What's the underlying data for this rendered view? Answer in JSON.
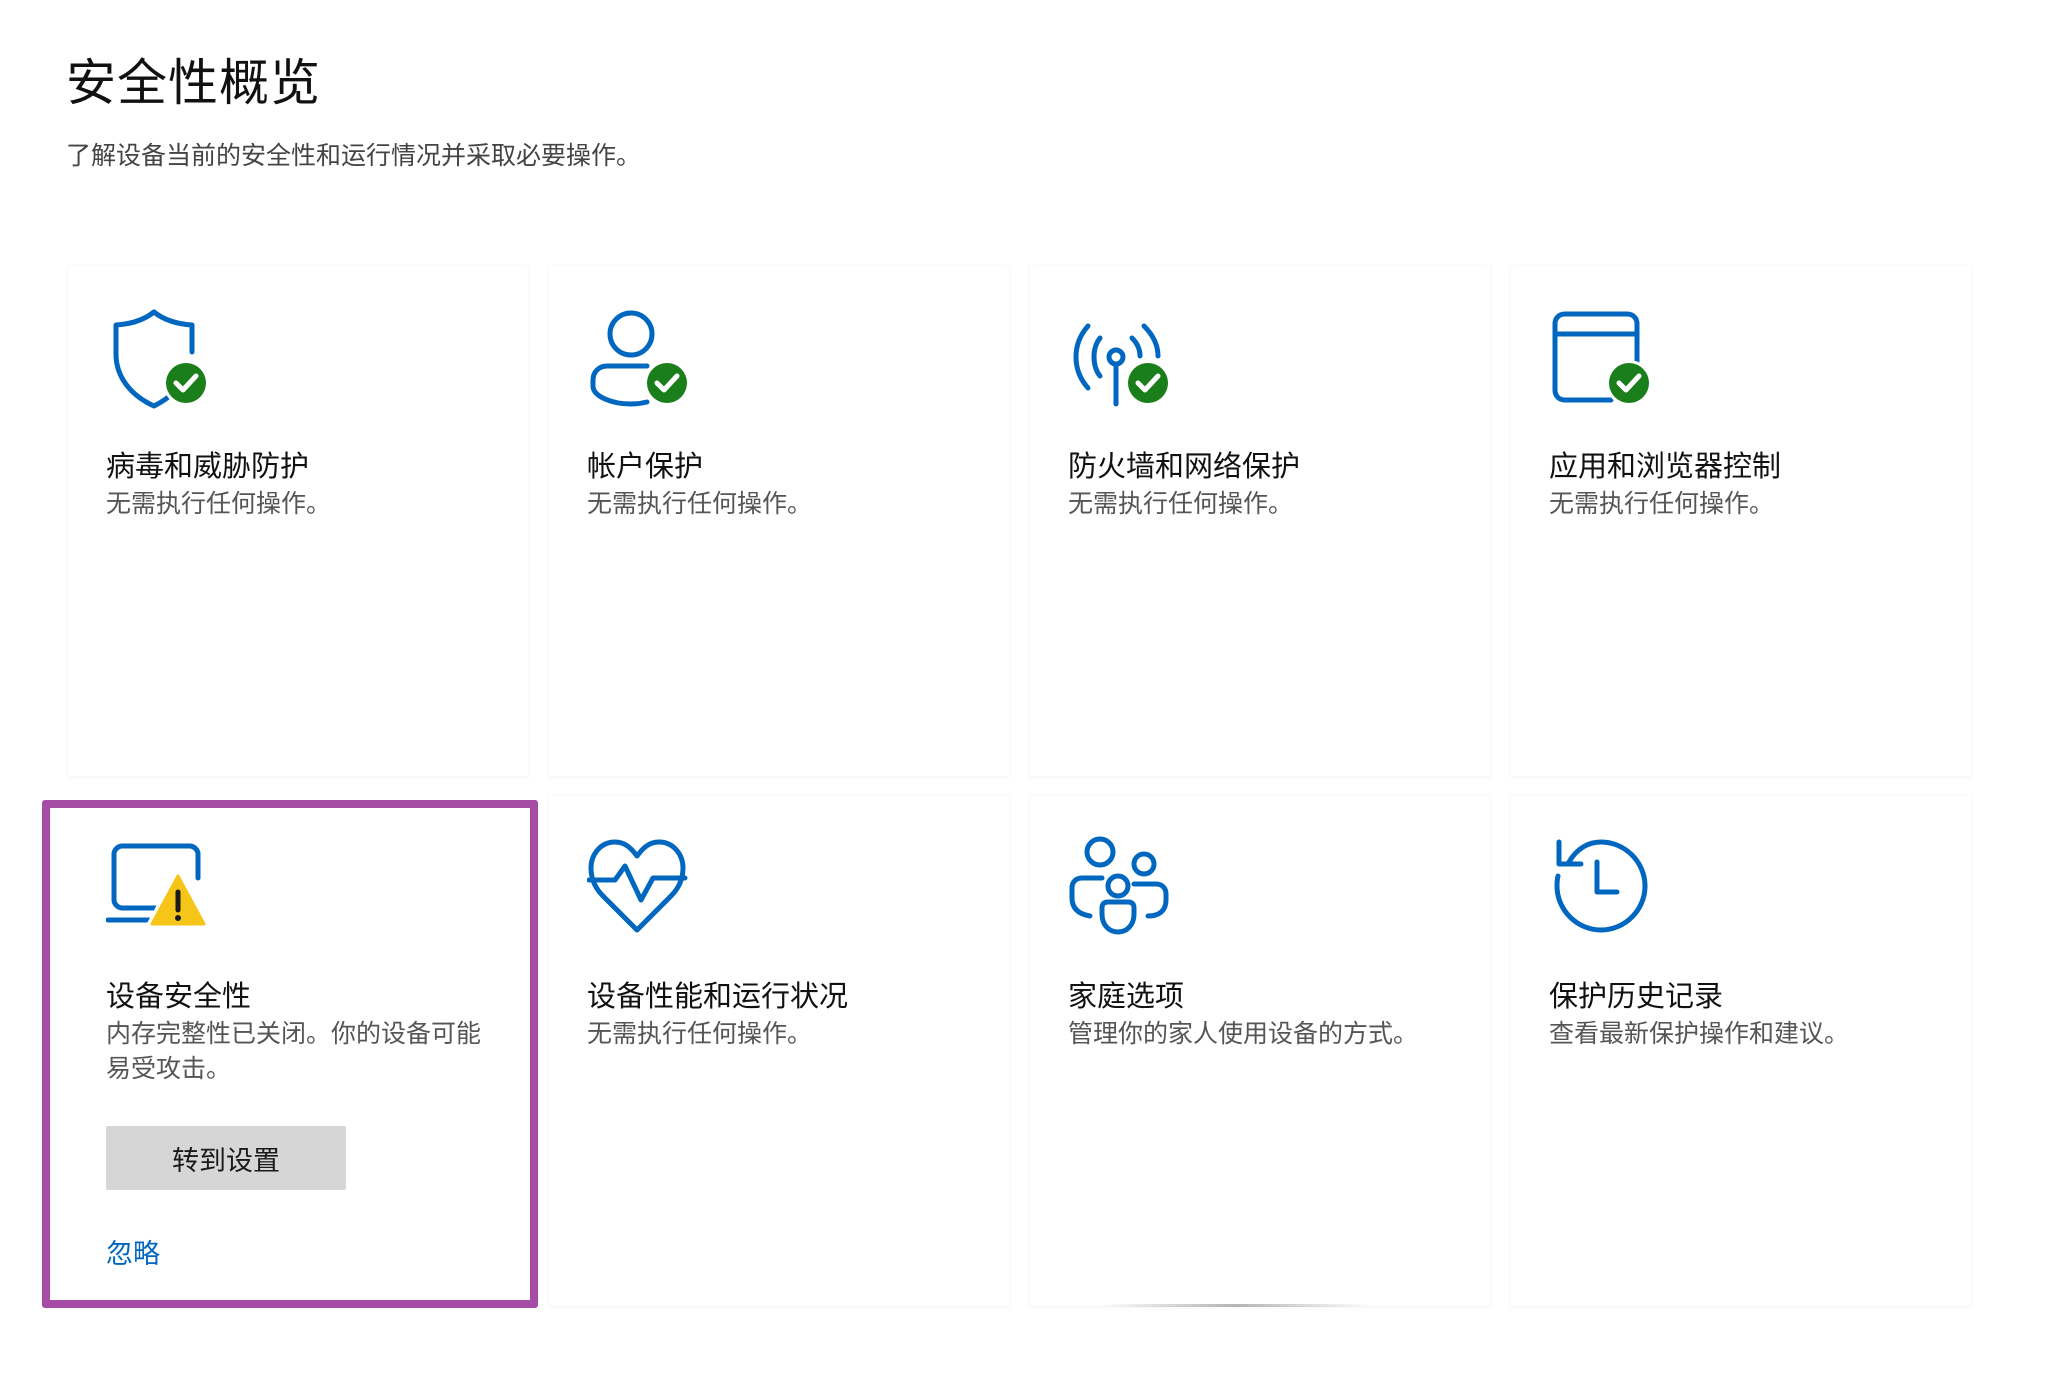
{
  "header": {
    "title": "安全性概览",
    "subtitle": "了解设备当前的安全性和运行情况并采取必要操作。"
  },
  "colors": {
    "icon_blue": "#0067c0",
    "ok_green": "#1a7f1a",
    "warning_yellow": "#f5c518",
    "highlight_purple": "#a64ca6",
    "button_gray": "#d6d6d6"
  },
  "cards": [
    {
      "id": "virus",
      "icon": "shield-icon",
      "status_icon": "check-icon",
      "title": "病毒和威胁防护",
      "desc": "无需执行任何操作。"
    },
    {
      "id": "account",
      "icon": "person-icon",
      "status_icon": "check-icon",
      "title": "帐户保护",
      "desc": "无需执行任何操作。"
    },
    {
      "id": "firewall",
      "icon": "antenna-icon",
      "status_icon": "check-icon",
      "title": "防火墙和网络保护",
      "desc": "无需执行任何操作。"
    },
    {
      "id": "app",
      "icon": "browser-window-icon",
      "status_icon": "check-icon",
      "title": "应用和浏览器控制",
      "desc": "无需执行任何操作。"
    },
    {
      "id": "device",
      "icon": "laptop-icon",
      "status_icon": "warning-icon",
      "title": "设备安全性",
      "desc": "内存完整性已关闭。你的设备可能易受攻击。",
      "button_label": "转到设置",
      "link_label": "忽略"
    },
    {
      "id": "health",
      "icon": "heart-pulse-icon",
      "title": "设备性能和运行状况",
      "desc": "无需执行任何操作。"
    },
    {
      "id": "family",
      "icon": "family-icon",
      "title": "家庭选项",
      "desc": "管理你的家人使用设备的方式。"
    },
    {
      "id": "history",
      "icon": "history-icon",
      "title": "保护历史记录",
      "desc": "查看最新保护操作和建议。"
    }
  ]
}
